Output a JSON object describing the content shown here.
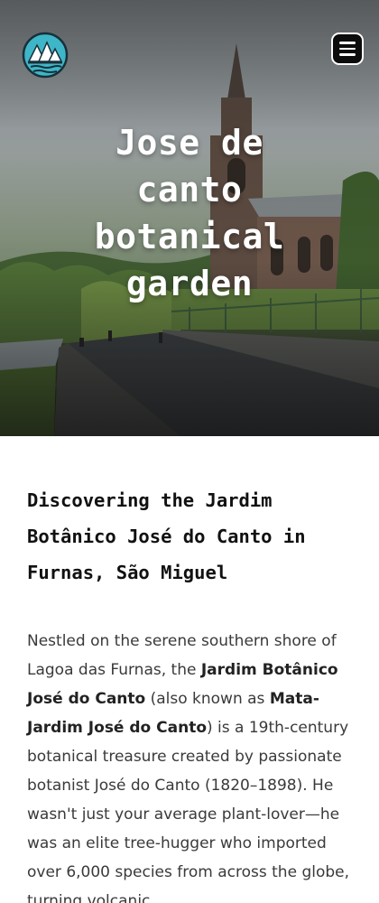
{
  "hero": {
    "title": "Jose de canto botanical garden",
    "logo_icon": "mountains-lake-logo",
    "menu_icon": "hamburger-menu-icon"
  },
  "article": {
    "heading": "Discovering the Jardim Botânico José do Canto in Furnas, São Miguel",
    "paragraph": {
      "t1": "Nestled on the serene southern shore of Lagoa das Furnas, the ",
      "b1": "Jardim Botânico José do Canto",
      "t2": " (also known as ",
      "b2": "Mata-Jardim José do Canto",
      "t3": ") is a 19th-century botanical treasure created by passionate botanist José do Canto (1820–1898). He wasn't just your average plant-lover—he was an elite tree-hugger who imported over 6,000 species from across the globe, turning volcanic"
    }
  },
  "colors": {
    "logo_teal": "#3fb6c7",
    "logo_dark": "#17303a",
    "menu_bg": "#0c0c0c",
    "heading": "#111111",
    "body_text": "#3a3a3a"
  }
}
